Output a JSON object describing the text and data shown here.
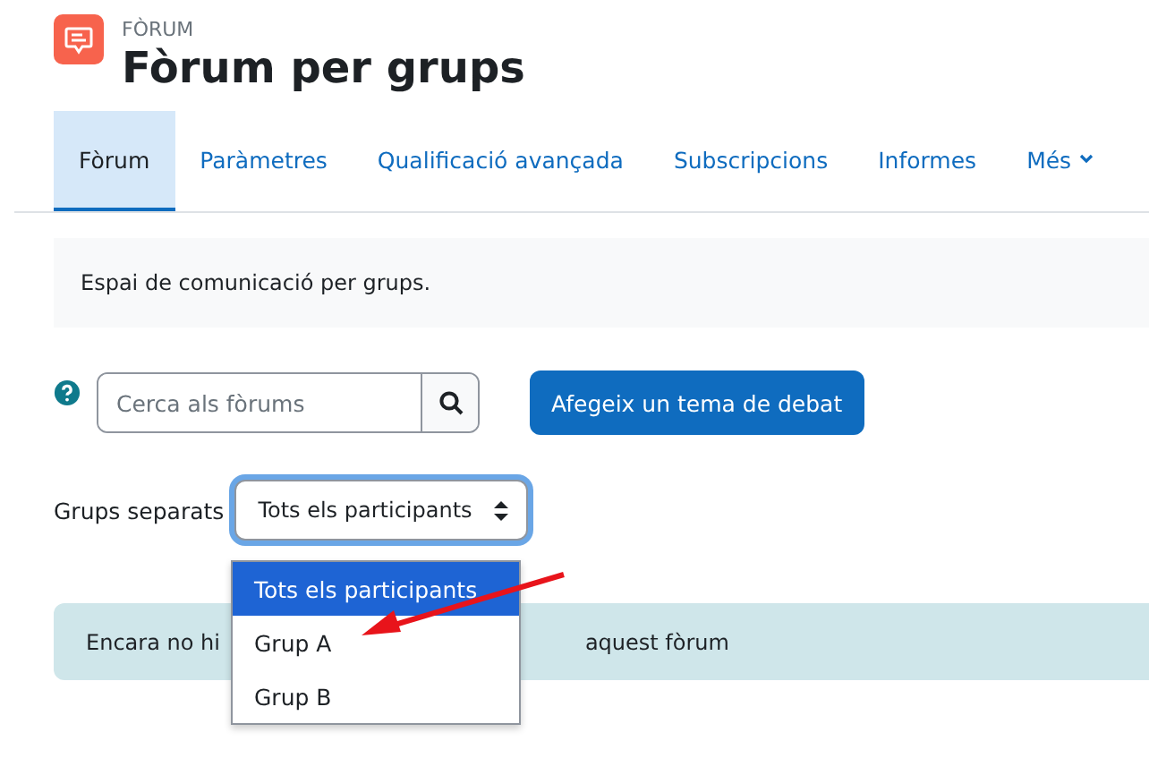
{
  "header": {
    "category": "FÒRUM",
    "title": "Fòrum per grups"
  },
  "tabs": [
    {
      "label": "Fòrum",
      "selected": true
    },
    {
      "label": "Paràmetres",
      "selected": false
    },
    {
      "label": "Qualificació avançada",
      "selected": false
    },
    {
      "label": "Subscripcions",
      "selected": false
    },
    {
      "label": "Informes",
      "selected": false
    },
    {
      "label": "Més",
      "selected": false,
      "kind": "menu"
    }
  ],
  "description": "Espai de comunicació per grups.",
  "search": {
    "placeholder": "Cerca als fòrums"
  },
  "add_button": "Afegeix un tema de debat",
  "groups": {
    "label": "Grups separats",
    "value": "Tots els participants",
    "expanded": true,
    "options": [
      {
        "label": "Tots els participants",
        "selected": true
      },
      {
        "label": "Grup A",
        "selected": false
      },
      {
        "label": "Grup B",
        "selected": false
      }
    ]
  },
  "notice": {
    "text_start": "Encara no hi",
    "text_end": "aquest fòrum"
  }
}
